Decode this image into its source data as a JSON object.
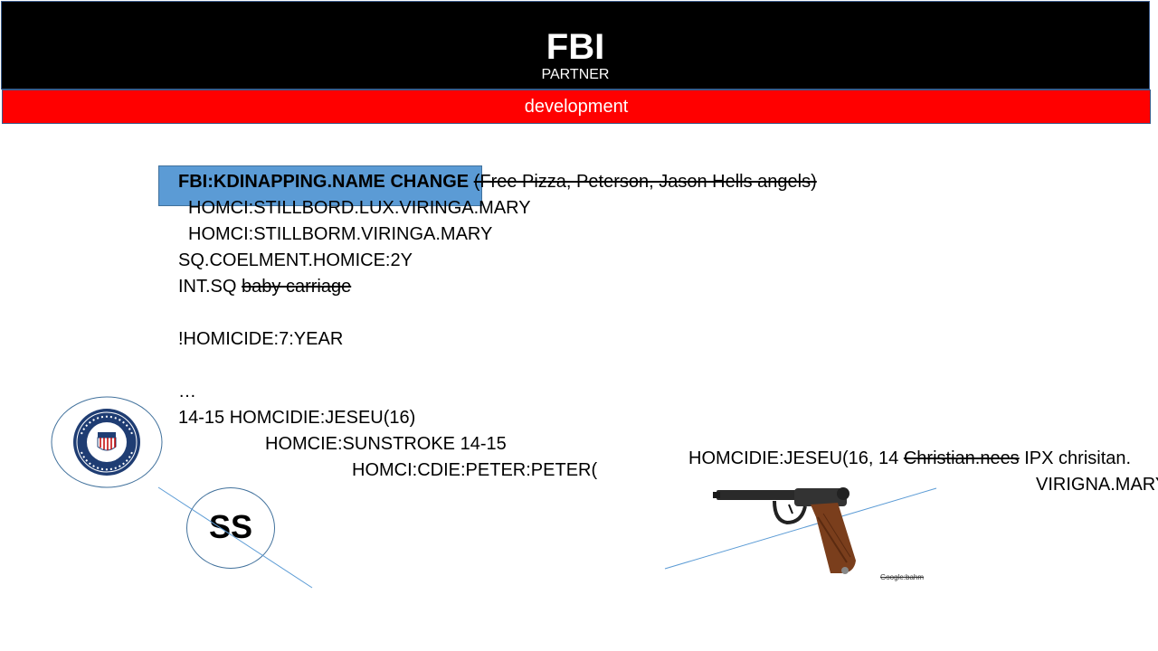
{
  "header": {
    "title": "FBI",
    "subtitle": "PARTNER"
  },
  "banner": {
    "label": "development"
  },
  "lines": {
    "l1_bold": "FBI:KDINAPPING.NAME CHANGE",
    "l1_space": " ",
    "l1_strike": "(Free Pizza, Peterson, Jason Hells angels)",
    "l2": "HOMCI:STILLBORD.LUX.VIRINGA.MARY",
    "l3": "HOMCI:STILLBORM.VIRINGA.MARY",
    "l4": "SQ.COELMENT.HOMICE:2Y",
    "l5_plain": "INT.SQ ",
    "l5_strike": "baby carriage",
    "l6": "!HOMICIDE:7:YEAR",
    "l7": "…",
    "l8": "14-15 HOMCIDIE:JESEU(16)",
    "l9": "HOMCIE:SUNSTROKE 14-15",
    "l10": "HOMCI:CDIE:PETER:PETER("
  },
  "right_block": {
    "r1_plain": "HOMCIDIE:JESEU(16, 14 ",
    "r1_strike": "Christian.nees",
    "r1_tail": " IPX chrisitan.",
    "r2": "VIRIGNA.MARY"
  },
  "ss_circle": {
    "label": "SS"
  },
  "image_credit": "Google:bahm",
  "colors": {
    "header": "#000000",
    "banner": "#ff0000",
    "highlight": "#5b9bd5",
    "outline": "#41719c"
  },
  "icons": {
    "ssa_seal": "social-security-seal-icon",
    "pistol": "pistol-image"
  }
}
